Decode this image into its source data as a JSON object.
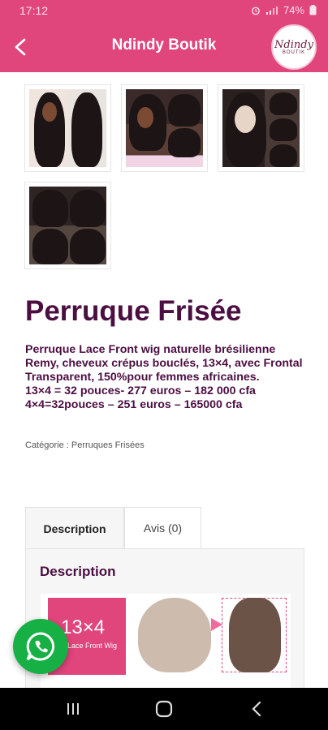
{
  "status_bar": {
    "time": "17:12",
    "battery": "74%",
    "icons": [
      "alarm-icon",
      "signal-icon",
      "battery-icon"
    ]
  },
  "header": {
    "title": "Ndindy Boutik",
    "back_icon": "chevron-left-icon",
    "logo_text": "Ndindy",
    "logo_subtext": "BOUTIK",
    "bg_color": "#e0457b"
  },
  "gallery": {
    "images": [
      "wig-photo-1",
      "wig-photo-2",
      "wig-photo-3",
      "wig-photo-4"
    ]
  },
  "product": {
    "title": "Perruque Frisée",
    "description_lines": [
      "Perruque Lace Front wig naturelle brésilienne Remy, cheveux crépus bouclés, 13×4, avec Frontal Transparent, 150%pour femmes africaines.",
      "13×4 = 32 pouces- 277 euros – 182 000 cfa",
      "4×4=32pouces – 251 euros – 165000 cfa"
    ],
    "category": "Catégorie : Perruques Frisées",
    "title_color": "#4b0e41"
  },
  "tabs": [
    {
      "label": "Description",
      "active": true
    },
    {
      "label": "Avis (0)",
      "active": false
    }
  ],
  "panel": {
    "heading": "Description",
    "banner_big_text": "13×4",
    "banner_small_text": "Lace Front Wig"
  },
  "whatsapp": {
    "icon": "whatsapp-icon",
    "color": "#17b045"
  },
  "nav_bar": {
    "icons": [
      "recent-apps-icon",
      "home-icon",
      "back-icon"
    ]
  }
}
